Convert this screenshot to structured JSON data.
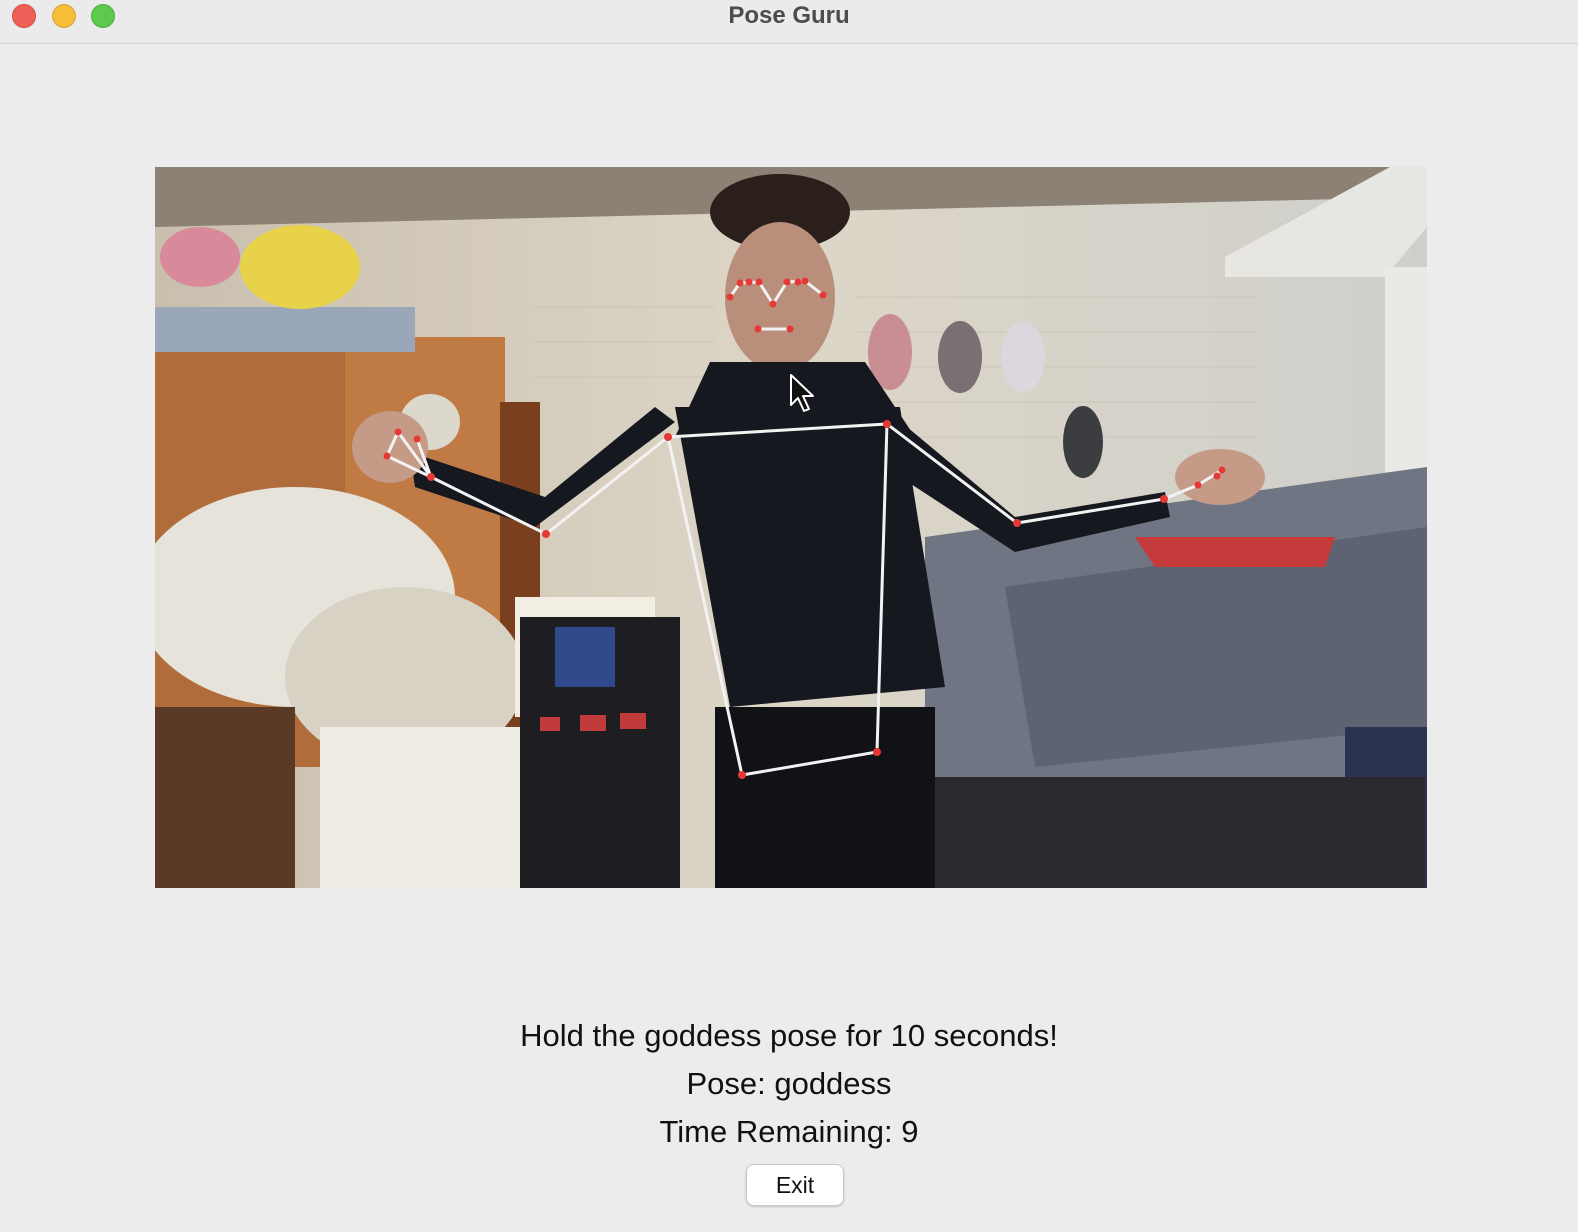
{
  "window": {
    "title": "Pose Guru",
    "controls": [
      "close",
      "minimize",
      "maximize"
    ]
  },
  "camera_feed": {
    "content": "webcam-frame-with-pose-skeleton",
    "skeleton_line_color": "#f2f2f2",
    "landmark_color": "#e53935"
  },
  "status": {
    "instruction": "Hold the goddess pose for 10 seconds!",
    "pose_label": "Pose: goddess",
    "timer_label": "Time Remaining: 9"
  },
  "buttons": {
    "exit_label": "Exit"
  },
  "icons": {
    "cursor": "arrow-pointer-icon"
  }
}
